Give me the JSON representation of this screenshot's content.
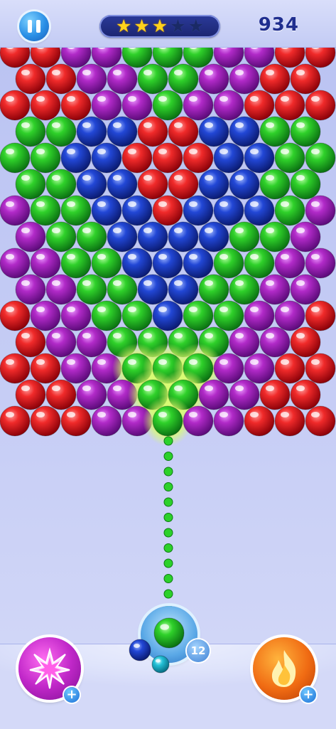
{
  "hud": {
    "score": "934",
    "stars_earned": 3,
    "stars_total": 5,
    "pause_icon": "pause-icon"
  },
  "shooter": {
    "current_bubble_color": "green",
    "next_bubbles": [
      "blue",
      "cyan"
    ],
    "shots_remaining": "12"
  },
  "powerups": {
    "left": {
      "icon": "bomb-burst-icon",
      "add_label": "+"
    },
    "right": {
      "icon": "fire-icon",
      "add_label": "+"
    }
  },
  "colors": {
    "red": "#e0141c",
    "purple": "#a51fb8",
    "green": "#22c21e",
    "blue": "#1b3fc8",
    "cyan": "#26c4d8",
    "star_on": "#ffd21c",
    "score_text": "#1f2e8f"
  },
  "board": {
    "rows": [
      "RRPPGGGPPRR",
      "RRPPGGPPRR",
      "RRRPPGPPRRR",
      "GGBBRRBBGG",
      "GGBBRRRBBGG",
      "GGBBRRBBGG",
      "PGGBBRBBBGP",
      "PGGBBBBGGP",
      "PPGGBBBGGPP",
      "PPGGBBGGPP",
      "RPPGGBGGPPR",
      "RPPGGGGPPR",
      "RRPPGGGPPRR",
      "RRPPGGPPRR",
      "RRRPPGPPRRR"
    ],
    "highlighted_cluster": [
      [
        12,
        4
      ],
      [
        12,
        5
      ],
      [
        12,
        6
      ],
      [
        13,
        4
      ],
      [
        13,
        5
      ],
      [
        14,
        5
      ]
    ]
  }
}
